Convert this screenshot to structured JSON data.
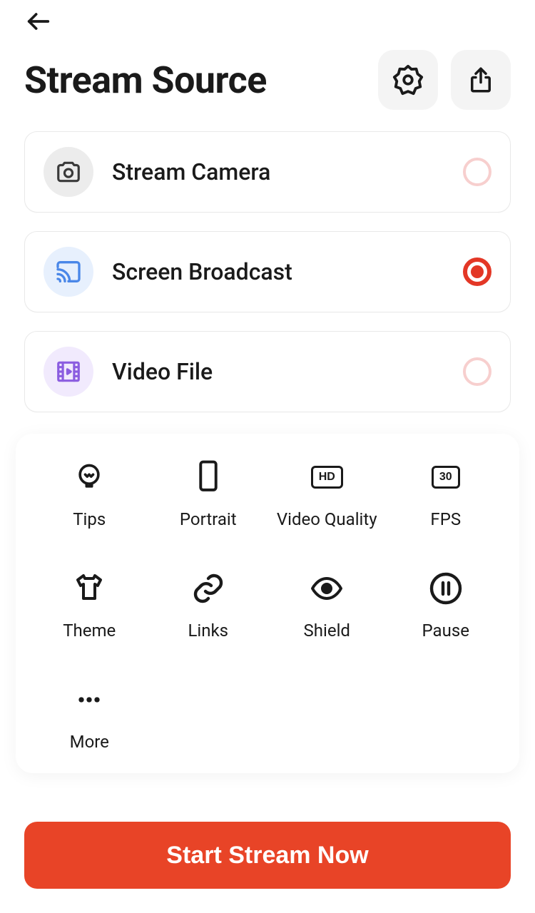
{
  "header": {
    "title": "Stream Source"
  },
  "sources": [
    {
      "label": "Stream Camera",
      "selected": false
    },
    {
      "label": "Screen Broadcast",
      "selected": true
    },
    {
      "label": "Video File",
      "selected": false
    }
  ],
  "options": {
    "tips": "Tips",
    "portrait": "Portrait",
    "video_quality": "Video Quality",
    "fps": "FPS",
    "hd_badge": "HD",
    "fps_badge": "30",
    "theme": "Theme",
    "links": "Links",
    "shield": "Shield",
    "pause": "Pause",
    "more": "More"
  },
  "cta": "Start Stream Now"
}
